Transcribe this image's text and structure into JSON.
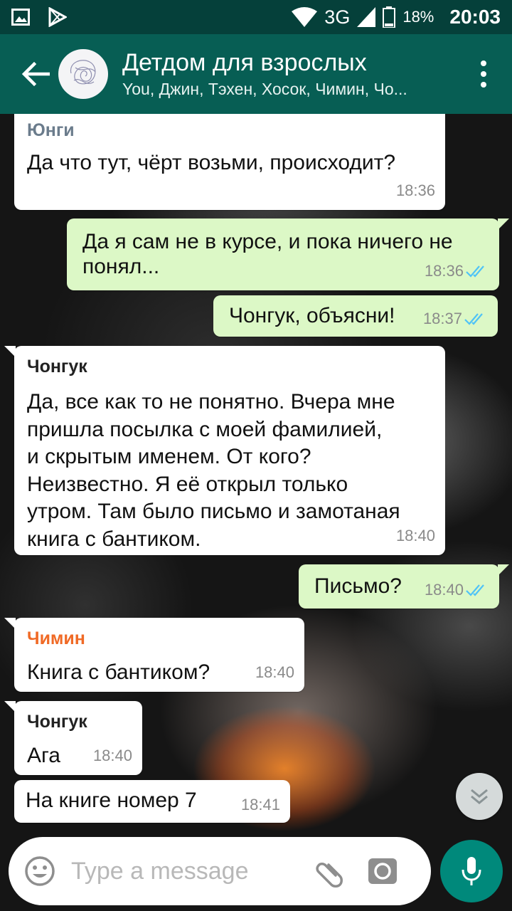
{
  "status_bar": {
    "network": "3G",
    "battery": "18%",
    "time": "20:03"
  },
  "header": {
    "title": "Детдом для взрослых",
    "subtitle": "You, Джин, Тэхен, Хосок, Чимин, Чо..."
  },
  "messages": [
    {
      "sender": "Юнги",
      "text": "Да что тут, чёрт возьми, происходит?",
      "time": "18:36"
    },
    {
      "text": "Да я сам не в курсе, и пока ничего не\nпонял...",
      "time": "18:36"
    },
    {
      "text": "Чонгук, объясни!",
      "time": "18:37"
    },
    {
      "sender": "Чонгук",
      "text": "Да, все как то не понятно. Вчера мне\nпришла посылка с моей фамилией,\nи скрытым именем. От кого?\nНеизвестно. Я её открыл только\nутром. Там было письмо и замотаная\nкнига с бантиком.",
      "time": "18:40"
    },
    {
      "text": "Письмо?",
      "time": "18:40"
    },
    {
      "sender": "Чимин",
      "text": "Книга с бантиком?",
      "time": "18:40"
    },
    {
      "sender": "Чонгук",
      "text": "Ага",
      "time": "18:40"
    },
    {
      "text": "На книге номер 7",
      "time": "18:41"
    }
  ],
  "input": {
    "placeholder": "Type a message"
  },
  "colors": {
    "header": "#075e54",
    "status_bar": "#05403a",
    "outgoing_bubble": "#dcf8c6",
    "incoming_bubble": "#ffffff",
    "read_ticks": "#4fc3f7",
    "mic_button": "#00897b",
    "sender_yungi": "#6b7c8c",
    "sender_jimin": "#f06a26"
  },
  "icons": [
    "image-icon",
    "play-store-icon",
    "wifi-icon",
    "signal-icon",
    "battery-icon",
    "back-arrow-icon",
    "group-avatar",
    "more-options-icon",
    "double-check-icon",
    "chevron-down-double-icon",
    "emoji-icon",
    "paperclip-icon",
    "camera-icon",
    "microphone-icon"
  ]
}
